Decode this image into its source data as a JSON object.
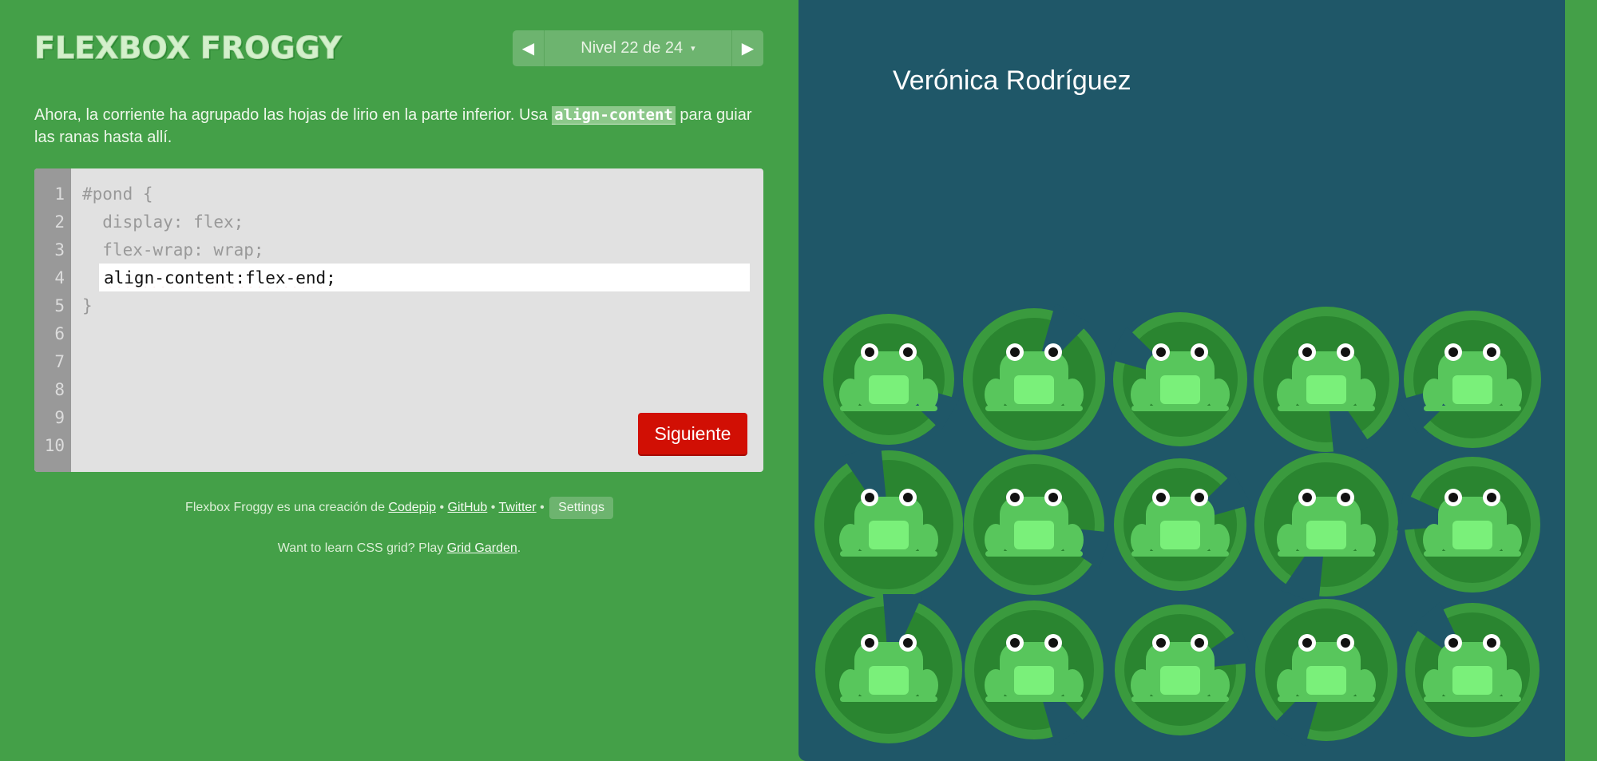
{
  "header": {
    "logo": "FLEXBOX FROGGY",
    "level_label": "Nivel 22 de 24",
    "caret": "▾",
    "prev_icon": "◀",
    "next_icon": "▶"
  },
  "instructions": {
    "before": "Ahora, la corriente ha agrupado las hojas de lirio en la parte inferior. Usa ",
    "code": "align-content",
    "after": " para guiar las ranas hasta allí."
  },
  "editor": {
    "line_numbers": [
      "1",
      "2",
      "3",
      "4",
      "5",
      "6",
      "7",
      "8",
      "9",
      "10"
    ],
    "lines": [
      "#pond {",
      "  display: flex;",
      "  flex-wrap: wrap;",
      "",
      "}"
    ],
    "input_value": "align-content:flex-end;",
    "next_button": "Siguiente"
  },
  "footer": {
    "credit_text": "Flexbox Froggy es una creación de ",
    "codepip": "Codepip",
    "sep": " • ",
    "github": "GitHub",
    "twitter": "Twitter",
    "settings": "Settings",
    "grid_prompt": "Want to learn CSS grid? Play ",
    "grid_link": "Grid Garden",
    "period": "."
  },
  "pond": {
    "player_name": "Verónica Rodríguez",
    "rows": 3,
    "per_row": 5,
    "frog_color": "green",
    "lilypad_color": "#2e8b32",
    "colors": {
      "background": "#1f5768",
      "lilypad_outer": "#3a9a3e",
      "lilypad_inner": "#2a8530",
      "frog_body": "#58c65c",
      "frog_belly": "#7af07a"
    }
  }
}
